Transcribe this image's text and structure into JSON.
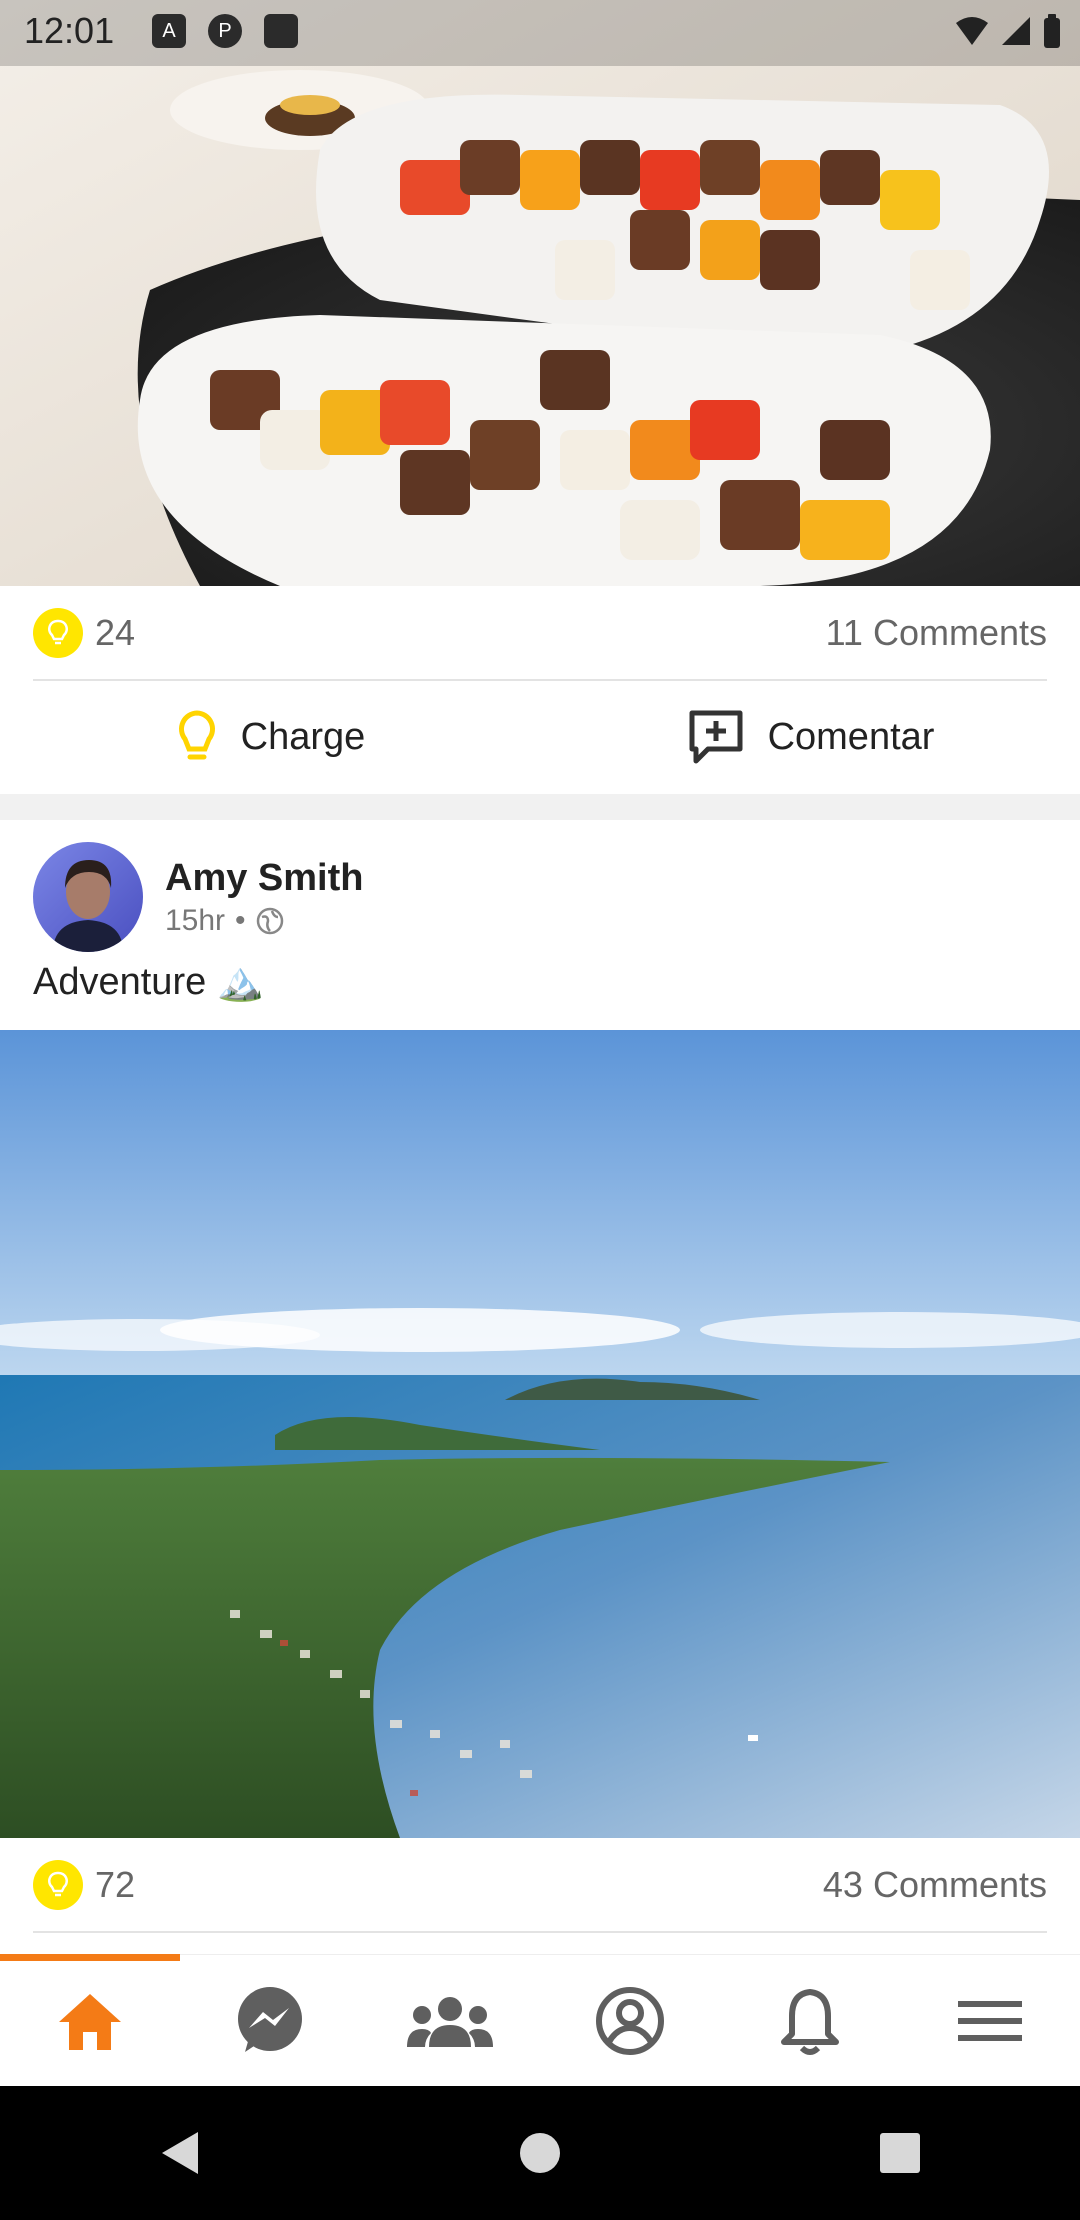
{
  "status_bar": {
    "time": "12:01",
    "notification_icons": [
      "A",
      "P",
      "SD"
    ]
  },
  "posts": [
    {
      "likes": "24",
      "comments": "11 Comments",
      "actions": {
        "charge_label": "Charge",
        "comment_label": "Comentar"
      }
    },
    {
      "author": "Amy Smith",
      "time": "15hr",
      "separator": "•",
      "text": "Adventure 🏔️",
      "likes": "72",
      "comments": "43 Comments"
    }
  ],
  "bottom_nav": {
    "items": [
      "home-icon",
      "messenger-icon",
      "groups-icon",
      "profile-icon",
      "bell-icon",
      "menu-icon"
    ],
    "active_index": 0
  },
  "colors": {
    "accent": "#f47b16",
    "bulb": "#ffe600",
    "text": "#222222",
    "muted": "#666666"
  }
}
